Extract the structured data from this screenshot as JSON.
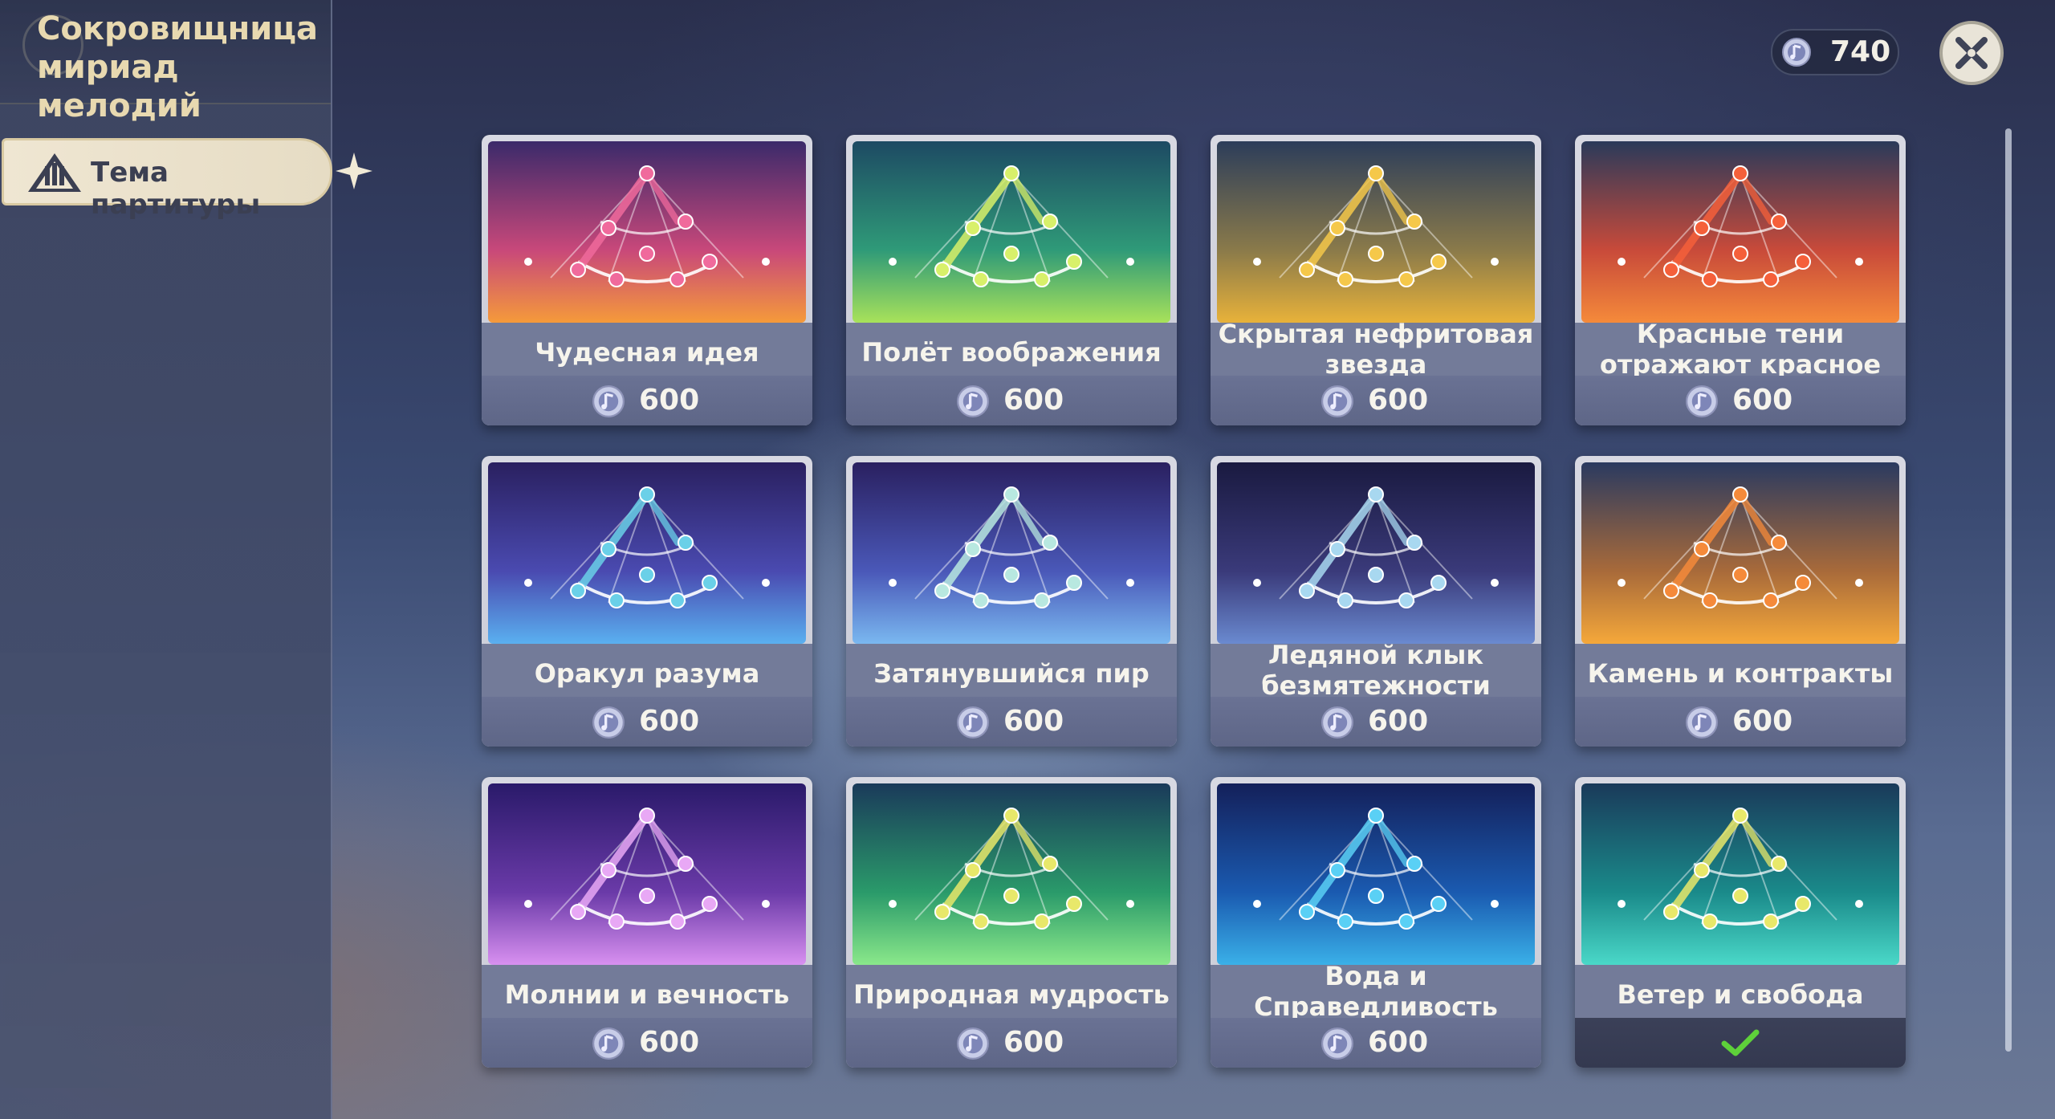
{
  "header": {
    "title": "Сокровищница\nмириад мелодий",
    "currency_amount": "740",
    "close_icon": "close-icon"
  },
  "sidebar": {
    "tabs": [
      {
        "label": "Тема партитуры",
        "icon": "warning-triangle-icon",
        "selected": true
      }
    ]
  },
  "colors": {
    "accent_gold": "#e8d9b0",
    "owned_check": "#5ed13a"
  },
  "cards": [
    {
      "name": "Чудесная идея",
      "price": "600",
      "owned": false,
      "palette": "pyro"
    },
    {
      "name": "Полёт воображения",
      "price": "600",
      "owned": false,
      "palette": "dendro-gold"
    },
    {
      "name": "Скрытая нефритовая звезда",
      "price": "600",
      "owned": false,
      "palette": "geo"
    },
    {
      "name": "Красные тени отражают красное",
      "price": "600",
      "owned": false,
      "palette": "pyro-red"
    },
    {
      "name": "Оракул разума",
      "price": "600",
      "owned": false,
      "palette": "hydro-violet"
    },
    {
      "name": "Затянувшийся пир",
      "price": "600",
      "owned": false,
      "palette": "cryo-violet"
    },
    {
      "name": "Ледяной клык безмятежности",
      "price": "600",
      "owned": false,
      "palette": "cryo-dark"
    },
    {
      "name": "Камень и контракты",
      "price": "600",
      "owned": false,
      "palette": "geo-orange"
    },
    {
      "name": "Молнии и вечность",
      "price": "600",
      "owned": false,
      "palette": "electro"
    },
    {
      "name": "Природная мудрость",
      "price": "600",
      "owned": false,
      "palette": "dendro"
    },
    {
      "name": "Вода и Справедливость",
      "price": "600",
      "owned": false,
      "palette": "hydro"
    },
    {
      "name": "Ветер и свобода",
      "price": "",
      "owned": true,
      "palette": "anemo"
    }
  ]
}
